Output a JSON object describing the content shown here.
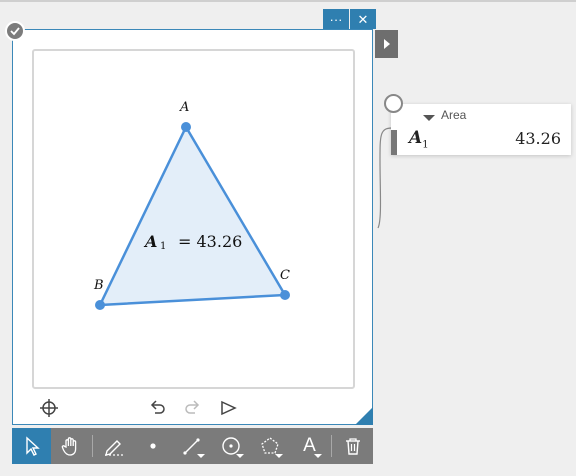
{
  "window": {
    "more_label": "···",
    "close_label": "✕"
  },
  "construction": {
    "points": [
      {
        "name": "A"
      },
      {
        "name": "B"
      },
      {
        "name": "C"
      }
    ],
    "area_label_name": "A",
    "area_label_sub": "1",
    "area_label_value": "= 43.26",
    "fill_color": "#e3eef9",
    "stroke_color": "#4a90d9"
  },
  "area_panel": {
    "header": "Area",
    "name": "A",
    "name_sub": "1",
    "value": "43.26"
  },
  "toolbar": {
    "tools": [
      {
        "name": "select-tool",
        "icon": "pointer-arrow"
      },
      {
        "name": "pan-tool",
        "icon": "hand"
      },
      {
        "name": "pen-tool",
        "icon": "pen"
      },
      {
        "name": "point-tool",
        "icon": "dot"
      },
      {
        "name": "line-tool",
        "icon": "line"
      },
      {
        "name": "circle-tool",
        "icon": "circle"
      },
      {
        "name": "polygon-tool",
        "icon": "pentagon"
      },
      {
        "name": "text-tool",
        "icon": "letter-A",
        "label": "A"
      },
      {
        "name": "delete-tool",
        "icon": "trash"
      }
    ]
  },
  "accent_color": "#2f7fb0"
}
